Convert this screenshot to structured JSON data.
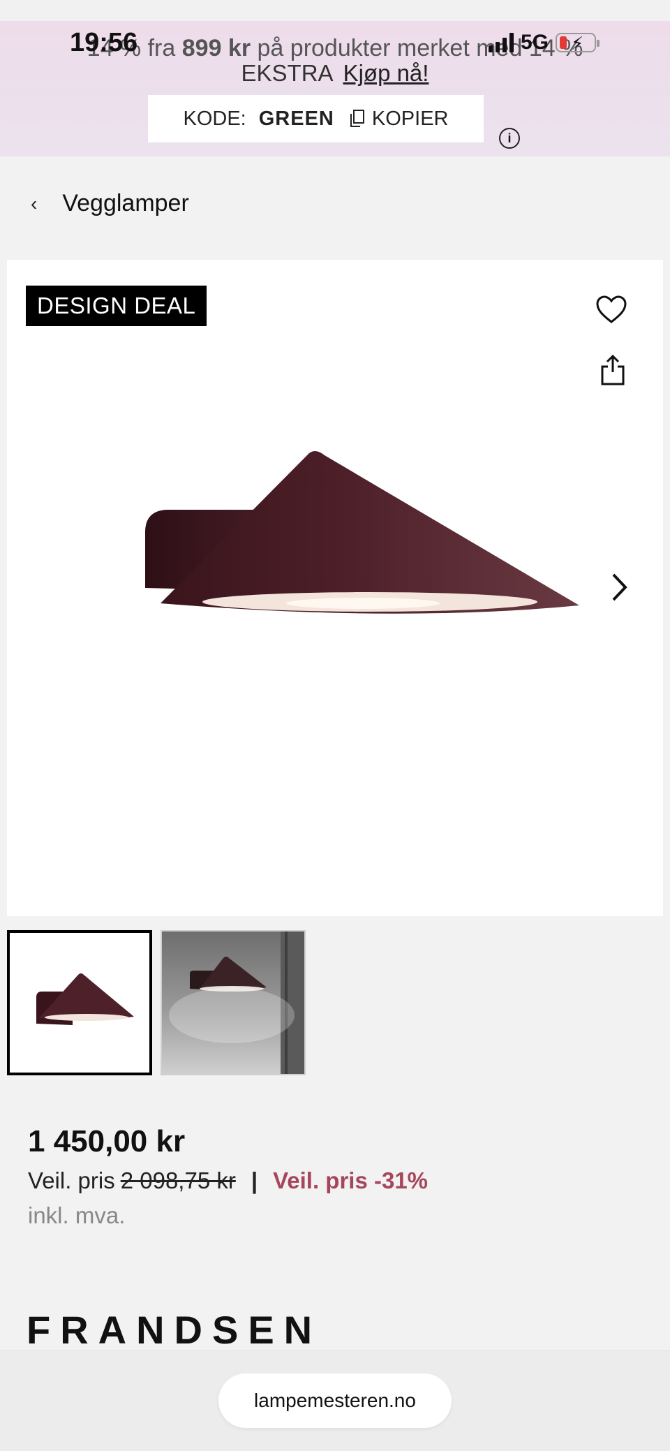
{
  "status_bar": {
    "time": "19:56",
    "network": "5G"
  },
  "promo": {
    "line1_prefix": "14 % fra ",
    "line1_amount": "899 kr",
    "line1_suffix": " på produkter merket med 14 %",
    "line2_text": "EKSTRA",
    "line2_link": "Kjøp nå!",
    "code_label": "KODE:",
    "code_value": "GREEN",
    "copy_label": "KOPIER"
  },
  "breadcrumb": {
    "label": "Vegglamper"
  },
  "product": {
    "badge": "DESIGN DEAL",
    "lamp_color": "#4a1f28",
    "price": "1 450,00 kr",
    "rrp_label": "Veil. pris",
    "rrp_value": "2 098,75 kr",
    "separator": "|",
    "discount_label": "Veil. pris -31%",
    "vat": "inkl. mva.",
    "brand": "FRANDSEN"
  },
  "browser": {
    "url": "lampemesteren.no"
  },
  "colors": {
    "promo_bg": "#ecdfec",
    "discount": "#a6455b",
    "badge_bg": "#000000"
  }
}
